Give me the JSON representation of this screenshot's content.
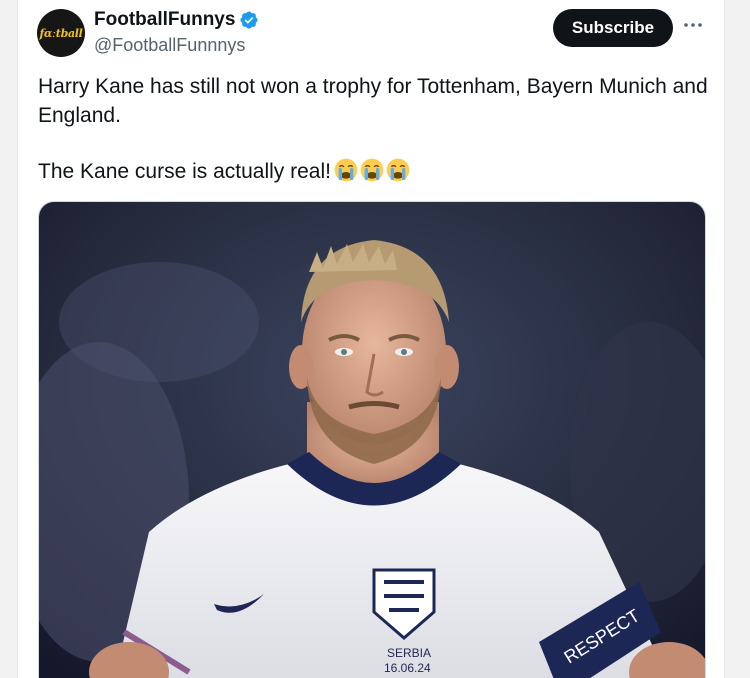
{
  "tweet": {
    "author": {
      "display_name": "FootballFunnys",
      "handle": "@FootballFunnnys",
      "avatar_text": "fɑːtball",
      "verified": true
    },
    "subscribe_label": "Subscribe",
    "text_lines": [
      "Harry Kane has still not won a trophy for Tottenham, Bayern Munich and England.",
      "The Kane curse is actually real!"
    ],
    "emojis": [
      "loudly-crying-face",
      "loudly-crying-face",
      "loudly-crying-face"
    ],
    "media": {
      "description_icon": "photo",
      "armband_text": "RESPECT",
      "badge_text": "SERBIA",
      "badge_date": "16.06.24"
    }
  },
  "colors": {
    "verified_blue": "#1d9bf0",
    "subscribe_bg": "#0f1419",
    "handle_gray": "#536471",
    "kit_navy": "#1d2756"
  }
}
